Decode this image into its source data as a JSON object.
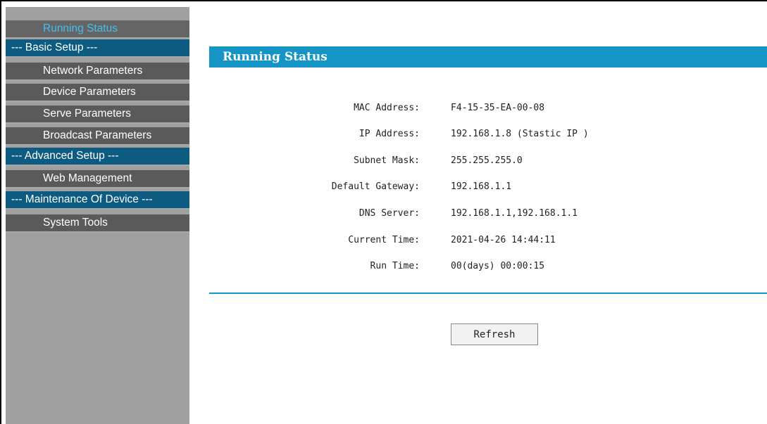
{
  "sidebar": {
    "items": [
      {
        "label": "Running Status",
        "type": "item",
        "active": true
      },
      {
        "label": "--- Basic Setup ---",
        "type": "group"
      },
      {
        "label": "Network Parameters",
        "type": "item"
      },
      {
        "label": "Device Parameters",
        "type": "item"
      },
      {
        "label": "Serve Parameters",
        "type": "item"
      },
      {
        "label": "Broadcast Parameters",
        "type": "item"
      },
      {
        "label": "--- Advanced Setup ---",
        "type": "group"
      },
      {
        "label": "Web Management",
        "type": "item"
      },
      {
        "label": "--- Maintenance Of Device ---",
        "type": "group"
      },
      {
        "label": "System Tools",
        "type": "item"
      }
    ]
  },
  "main": {
    "title": "Running Status",
    "fields": [
      {
        "label": "MAC Address:",
        "value": "F4-15-35-EA-00-08"
      },
      {
        "label": "IP Address:",
        "value": "192.168.1.8 (Stastic IP )"
      },
      {
        "label": "Subnet Mask:",
        "value": "255.255.255.0"
      },
      {
        "label": "Default Gateway:",
        "value": "192.168.1.1"
      },
      {
        "label": "DNS Server:",
        "value": "192.168.1.1,192.168.1.1"
      },
      {
        "label": "Current Time:",
        "value": "2021-04-26 14:44:11"
      },
      {
        "label": "Run Time:",
        "value": "00(days) 00:00:15"
      }
    ],
    "refresh_label": "Refresh"
  },
  "colors": {
    "title_bar": "#1594c6",
    "group_header": "#0d5b80",
    "nav_item": "#5a5a5a",
    "active_text": "#3fc0f0",
    "sidebar_bg": "#a0a0a0"
  }
}
